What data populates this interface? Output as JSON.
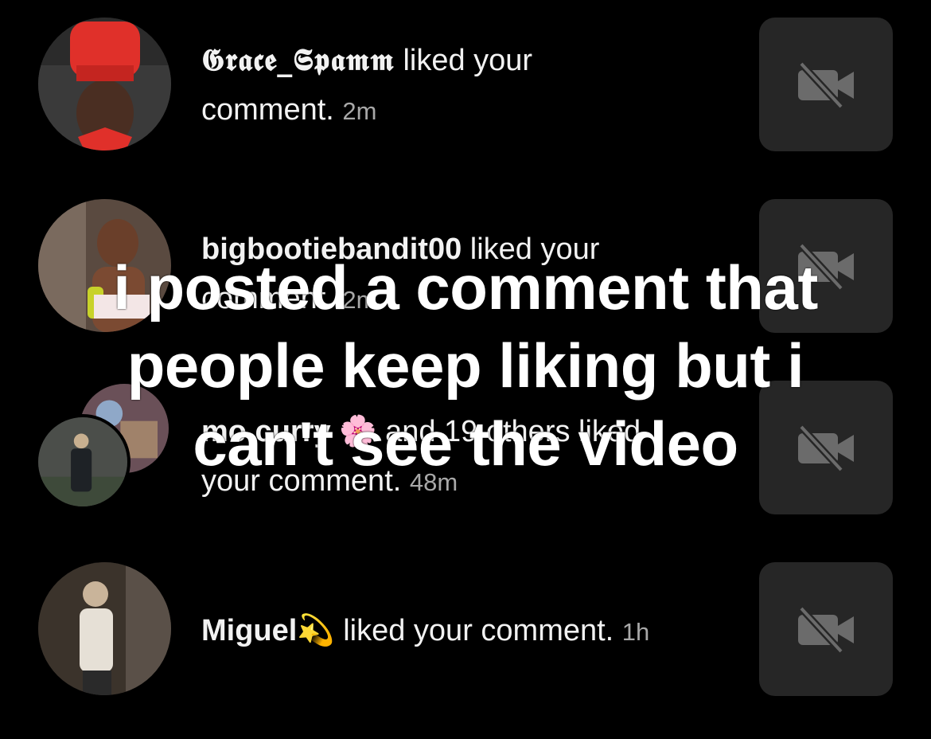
{
  "notifications": [
    {
      "username": "𝕲𝖗𝖆𝖈𝖊_𝕾𝖕𝖆𝖒𝖒",
      "action": " liked your",
      "action2": "comment.",
      "time": "2m"
    },
    {
      "username": "bigbootiebandit00",
      "action": " liked your",
      "action2": "comment.",
      "time": "2m"
    },
    {
      "username": "mo curry",
      "username_emoji": "🌸",
      "action": " and 19 others liked",
      "action2": "your comment.",
      "time": "48m"
    },
    {
      "username": "Miguel",
      "username_emoji": "💫",
      "action": " liked your comment.",
      "time": "1h"
    }
  ],
  "overlay_caption": {
    "line1": "i posted a comment that",
    "line2": "people keep liking but i",
    "line3": "can't see the video"
  },
  "icons": {
    "thumbnail": "video-off-icon"
  },
  "colors": {
    "background": "#000000",
    "thumbnail_bg": "#262626",
    "time_text": "#a8a8a8",
    "icon": "#6b6b6b"
  }
}
